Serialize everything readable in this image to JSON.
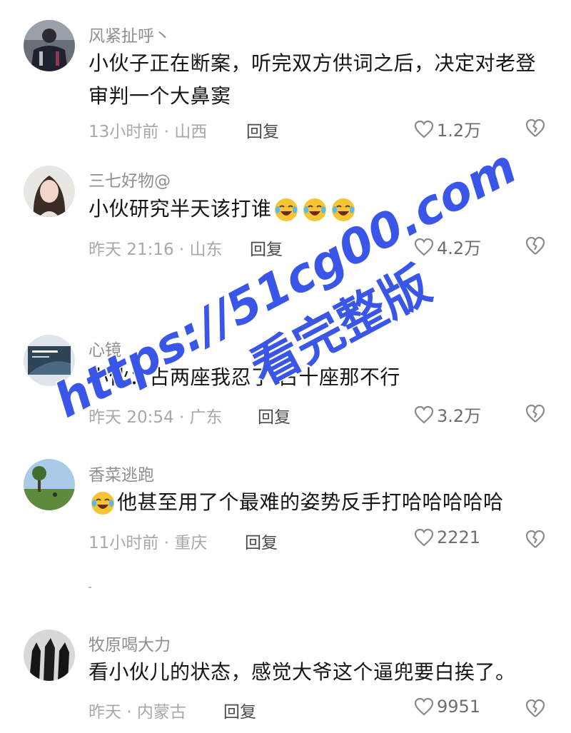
{
  "comments": [
    {
      "username": "风紧扯呼丶",
      "text": "小伙子正在断案，听完双方供词之后，决定对老登审判一个大鼻窦",
      "meta": "13小时前 · 山西",
      "reply_label": "回复",
      "likes": "1.2万",
      "avatar_icon": "person-in-jacket-avatar"
    },
    {
      "username": "三七好物@",
      "text": "小伙研究半天该打谁",
      "emojis": [
        "crying-laughing-emoji",
        "crying-laughing-emoji",
        "crying-laughing-emoji"
      ],
      "meta": "昨天 21:16 · 山东",
      "reply_label": "回复",
      "likes": "4.2万",
      "avatar_icon": "woman-portrait-avatar"
    },
    {
      "username": "心镜",
      "text": "小伙：占两座我忍了 占十座那不行",
      "meta": "昨天 20:54 · 广东",
      "reply_label": "回复",
      "likes": "3.2万",
      "avatar_icon": "slide-thumbnail-avatar"
    },
    {
      "username": "香菜逃跑",
      "text": "他甚至用了个最难的姿势反手打哈哈哈哈哈",
      "emoji_prefix": "crying-laughing-emoji",
      "meta": "11小时前 · 重庆",
      "reply_label": "回复",
      "likes": "2221",
      "avatar_icon": "landscape-tree-avatar"
    },
    {
      "username": "牧原喝大力",
      "text": "看小伙儿的状态，感觉大爷这个逼兜要白挨了。",
      "meta": "昨天 · 内蒙古",
      "reply_label": "回复",
      "likes": "9951",
      "avatar_icon": "dark-horses-avatar"
    }
  ],
  "watermark": {
    "url": "https://51cg00.com",
    "caption": "看完整版",
    "color": "#3a56e8"
  },
  "icons": {
    "like": "heart-outline-icon",
    "dislike": "broken-heart-icon"
  }
}
